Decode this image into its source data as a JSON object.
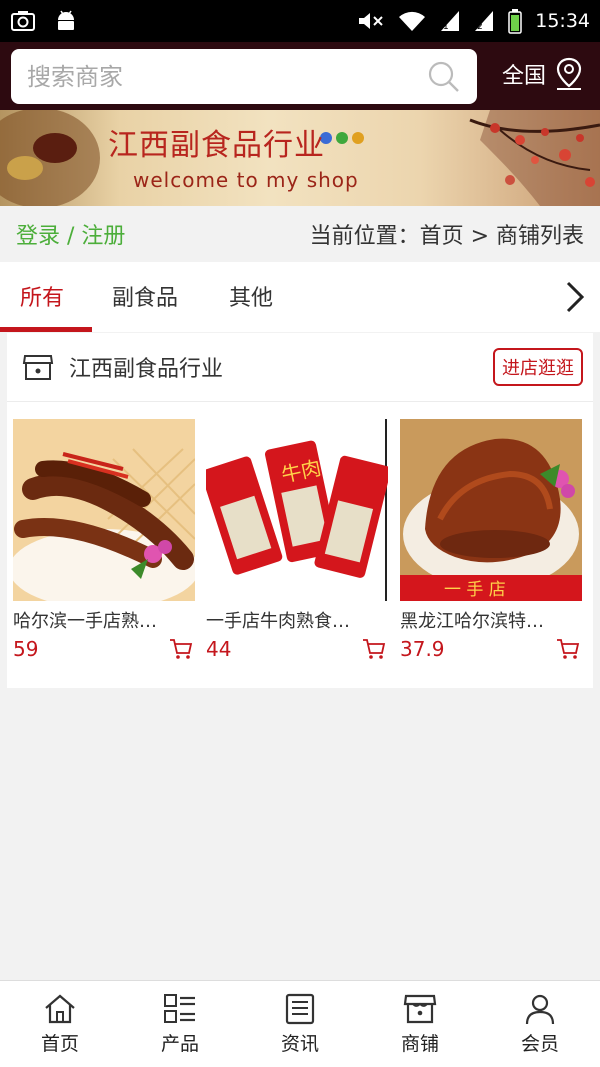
{
  "status_bar": {
    "time": "15:34"
  },
  "header": {
    "search_placeholder": "搜索商家",
    "region_label": "全国"
  },
  "banner": {
    "title": "江西副食品行业",
    "subtitle": "welcome  to  my shop"
  },
  "location_bar": {
    "login_register": "登录 / 注册",
    "breadcrumb": "当前位置：首页 > 商铺列表"
  },
  "tabs": [
    {
      "label": "所有",
      "active": true
    },
    {
      "label": "副食品",
      "active": false
    },
    {
      "label": "其他",
      "active": false
    }
  ],
  "shop": {
    "name": "江西副食品行业",
    "visit_button": "进店逛逛",
    "products": [
      {
        "name": "哈尔滨一手店熟…",
        "price": "59"
      },
      {
        "name": "一手店牛肉熟食…",
        "price": "44",
        "pack_text": "牛肉"
      },
      {
        "name": "黑龙江哈尔滨特…",
        "price": "37.9",
        "label_text": "一 手 店"
      }
    ]
  },
  "bottom_nav": [
    {
      "label": "首页",
      "icon": "home-icon"
    },
    {
      "label": "产品",
      "icon": "list-icon"
    },
    {
      "label": "资讯",
      "icon": "news-icon"
    },
    {
      "label": "商铺",
      "icon": "shop-icon"
    },
    {
      "label": "会员",
      "icon": "user-icon"
    }
  ],
  "colors": {
    "accent": "#c4161c",
    "login": "#4cae3a",
    "header_bg": "#2d0a10"
  }
}
